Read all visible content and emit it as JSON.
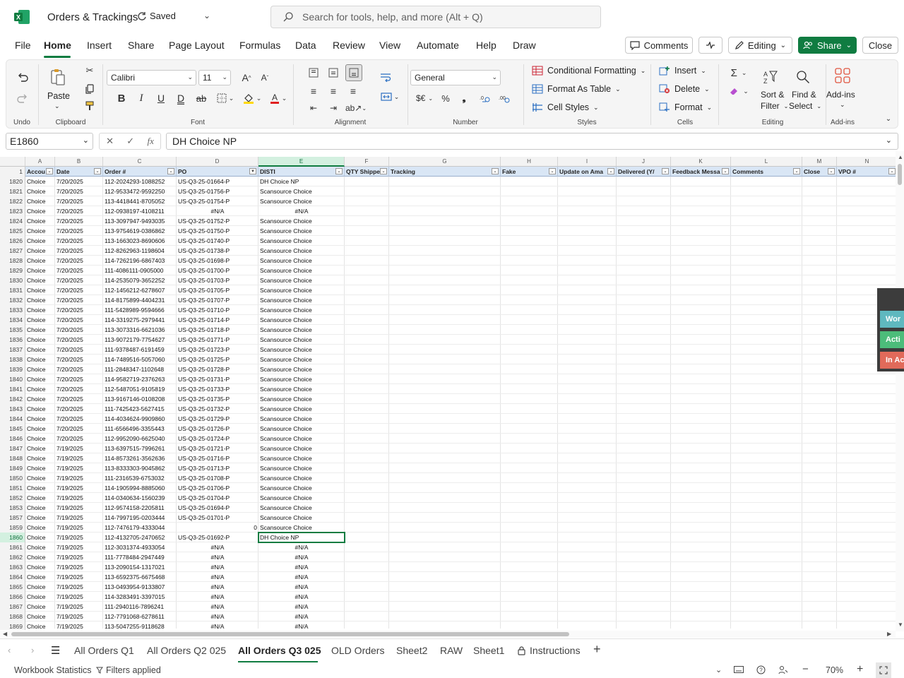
{
  "app": {
    "title": "Orders & Trackings",
    "saved_status": "Saved",
    "search_placeholder": "Search for tools, help, and more (Alt + Q)"
  },
  "menu": {
    "items": [
      "File",
      "Home",
      "Insert",
      "Share",
      "Page Layout",
      "Formulas",
      "Data",
      "Review",
      "View",
      "Automate",
      "Help",
      "Draw"
    ],
    "active": "Home",
    "comments": "Comments",
    "editing": "Editing",
    "share": "Share",
    "close": "Close"
  },
  "ribbon": {
    "undo_label": "Undo",
    "paste_label": "Paste",
    "clipboard_label": "Clipboard",
    "font_name": "Calibri",
    "font_size": "11",
    "font_label": "Font",
    "alignment_label": "Alignment",
    "number_format": "General",
    "number_label": "Number",
    "conditional_formatting": "Conditional Formatting",
    "format_as_table": "Format As Table",
    "cell_styles": "Cell Styles",
    "styles_label": "Styles",
    "insert": "Insert",
    "delete": "Delete",
    "format": "Format",
    "cells_label": "Cells",
    "sort_filter_1": "Sort &",
    "sort_filter_2": "Filter",
    "find_select_1": "Find &",
    "find_select_2": "Select",
    "editing_label": "Editing",
    "addins": "Add-ins",
    "addins_label": "Add-ins"
  },
  "formula_bar": {
    "name_box": "E1860",
    "formula": "DH Choice NP"
  },
  "columns": [
    {
      "letter": "A",
      "header": "Accou"
    },
    {
      "letter": "B",
      "header": "Date"
    },
    {
      "letter": "C",
      "header": "Order #"
    },
    {
      "letter": "D",
      "header": "PO"
    },
    {
      "letter": "E",
      "header": "DISTI"
    },
    {
      "letter": "F",
      "header": "QTY Shippe"
    },
    {
      "letter": "G",
      "header": "Tracking"
    },
    {
      "letter": "H",
      "header": "Fake"
    },
    {
      "letter": "I",
      "header": "Update on Ama"
    },
    {
      "letter": "J",
      "header": "Delivered (Y/"
    },
    {
      "letter": "K",
      "header": "Feedback Messa"
    },
    {
      "letter": "L",
      "header": "Comments"
    },
    {
      "letter": "M",
      "header": "Close"
    },
    {
      "letter": "N",
      "header": "VPO #"
    }
  ],
  "header_row_number": "1",
  "rows": [
    {
      "n": "1820",
      "a": "Choice",
      "b": "7/20/2025",
      "c": "112-2024293-1088252",
      "d": "US-Q3-25-01664-P",
      "e": "DH Choice NP",
      "f": ""
    },
    {
      "n": "1821",
      "a": "Choice",
      "b": "7/20/2025",
      "c": "112-9533472-9592250",
      "d": "US-Q3-25-01756-P",
      "e": "Scansource Choice",
      "f": ""
    },
    {
      "n": "1822",
      "a": "Choice",
      "b": "7/20/2025",
      "c": "113-4418441-8705052",
      "d": "US-Q3-25-01754-P",
      "e": "Scansource Choice",
      "f": ""
    },
    {
      "n": "1823",
      "a": "Choice",
      "b": "7/20/2025",
      "c": "112-0938197-4108211",
      "d": "#N/A",
      "e": "#N/A",
      "f": ""
    },
    {
      "n": "1824",
      "a": "Choice",
      "b": "7/20/2025",
      "c": "113-3097947-9493035",
      "d": "US-Q3-25-01752-P",
      "e": "Scansource Choice",
      "f": ""
    },
    {
      "n": "1825",
      "a": "Choice",
      "b": "7/20/2025",
      "c": "113-9754619-0386862",
      "d": "US-Q3-25-01750-P",
      "e": "Scansource Choice",
      "f": ""
    },
    {
      "n": "1826",
      "a": "Choice",
      "b": "7/20/2025",
      "c": "113-1663023-8690606",
      "d": "US-Q3-25-01740-P",
      "e": "Scansource Choice",
      "f": ""
    },
    {
      "n": "1827",
      "a": "Choice",
      "b": "7/20/2025",
      "c": "112-8262963-1198604",
      "d": "US-Q3-25-01738-P",
      "e": "Scansource Choice",
      "f": ""
    },
    {
      "n": "1828",
      "a": "Choice",
      "b": "7/20/2025",
      "c": "114-7262196-6867403",
      "d": "US-Q3-25-01698-P",
      "e": "Scansource Choice",
      "f": ""
    },
    {
      "n": "1829",
      "a": "Choice",
      "b": "7/20/2025",
      "c": "111-4086111-0905000",
      "d": "US-Q3-25-01700-P",
      "e": "Scansource Choice",
      "f": ""
    },
    {
      "n": "1830",
      "a": "Choice",
      "b": "7/20/2025",
      "c": "114-2535079-3652252",
      "d": "US-Q3-25-01703-P",
      "e": "Scansource Choice",
      "f": ""
    },
    {
      "n": "1831",
      "a": "Choice",
      "b": "7/20/2025",
      "c": "112-1456212-6278607",
      "d": "US-Q3-25-01705-P",
      "e": "Scansource Choice",
      "f": ""
    },
    {
      "n": "1832",
      "a": "Choice",
      "b": "7/20/2025",
      "c": "114-8175899-4404231",
      "d": "US-Q3-25-01707-P",
      "e": "Scansource Choice",
      "f": ""
    },
    {
      "n": "1833",
      "a": "Choice",
      "b": "7/20/2025",
      "c": "111-5428989-9594666",
      "d": "US-Q3-25-01710-P",
      "e": "Scansource Choice",
      "f": ""
    },
    {
      "n": "1834",
      "a": "Choice",
      "b": "7/20/2025",
      "c": "114-3319275-2979441",
      "d": "US-Q3-25-01714-P",
      "e": "Scansource Choice",
      "f": ""
    },
    {
      "n": "1835",
      "a": "Choice",
      "b": "7/20/2025",
      "c": "113-3073316-6621036",
      "d": "US-Q3-25-01718-P",
      "e": "Scansource Choice",
      "f": ""
    },
    {
      "n": "1836",
      "a": "Choice",
      "b": "7/20/2025",
      "c": "113-9072179-7754627",
      "d": "US-Q3-25-01771-P",
      "e": "Scansource Choice",
      "f": ""
    },
    {
      "n": "1837",
      "a": "Choice",
      "b": "7/20/2025",
      "c": "111-9378487-6191459",
      "d": "US-Q3-25-01723-P",
      "e": "Scansource Choice",
      "f": ""
    },
    {
      "n": "1838",
      "a": "Choice",
      "b": "7/20/2025",
      "c": "114-7489516-5057060",
      "d": "US-Q3-25-01725-P",
      "e": "Scansource Choice",
      "f": ""
    },
    {
      "n": "1839",
      "a": "Choice",
      "b": "7/20/2025",
      "c": "111-2848347-1102648",
      "d": "US-Q3-25-01728-P",
      "e": "Scansource Choice",
      "f": ""
    },
    {
      "n": "1840",
      "a": "Choice",
      "b": "7/20/2025",
      "c": "114-9582719-2376263",
      "d": "US-Q3-25-01731-P",
      "e": "Scansource Choice",
      "f": ""
    },
    {
      "n": "1841",
      "a": "Choice",
      "b": "7/20/2025",
      "c": "112-5487051-9105819",
      "d": "US-Q3-25-01733-P",
      "e": "Scansource Choice",
      "f": ""
    },
    {
      "n": "1842",
      "a": "Choice",
      "b": "7/20/2025",
      "c": "113-9167146-0108208",
      "d": "US-Q3-25-01735-P",
      "e": "Scansource Choice",
      "f": ""
    },
    {
      "n": "1843",
      "a": "Choice",
      "b": "7/20/2025",
      "c": "111-7425423-5627415",
      "d": "US-Q3-25-01732-P",
      "e": "Scansource Choice",
      "f": ""
    },
    {
      "n": "1844",
      "a": "Choice",
      "b": "7/20/2025",
      "c": "114-4034624-9909860",
      "d": "US-Q3-25-01729-P",
      "e": "Scansource Choice",
      "f": ""
    },
    {
      "n": "1845",
      "a": "Choice",
      "b": "7/20/2025",
      "c": "111-6566496-3355443",
      "d": "US-Q3-25-01726-P",
      "e": "Scansource Choice",
      "f": ""
    },
    {
      "n": "1846",
      "a": "Choice",
      "b": "7/20/2025",
      "c": "112-9952090-6625040",
      "d": "US-Q3-25-01724-P",
      "e": "Scansource Choice",
      "f": ""
    },
    {
      "n": "1847",
      "a": "Choice",
      "b": "7/19/2025",
      "c": "113-6397515-7996261",
      "d": "US-Q3-25-01721-P",
      "e": "Scansource Choice",
      "f": ""
    },
    {
      "n": "1848",
      "a": "Choice",
      "b": "7/19/2025",
      "c": "114-8573261-3562636",
      "d": "US-Q3-25-01716-P",
      "e": "Scansource Choice",
      "f": ""
    },
    {
      "n": "1849",
      "a": "Choice",
      "b": "7/19/2025",
      "c": "113-8333303-9045862",
      "d": "US-Q3-25-01713-P",
      "e": "Scansource Choice",
      "f": ""
    },
    {
      "n": "1850",
      "a": "Choice",
      "b": "7/19/2025",
      "c": "111-2316539-6753032",
      "d": "US-Q3-25-01708-P",
      "e": "Scansource Choice",
      "f": ""
    },
    {
      "n": "1851",
      "a": "Choice",
      "b": "7/19/2025",
      "c": "114-1905994-8885060",
      "d": "US-Q3-25-01706-P",
      "e": "Scansource Choice",
      "f": ""
    },
    {
      "n": "1852",
      "a": "Choice",
      "b": "7/19/2025",
      "c": "114-0340634-1560239",
      "d": "US-Q3-25-01704-P",
      "e": "Scansource Choice",
      "f": ""
    },
    {
      "n": "1853",
      "a": "Choice",
      "b": "7/19/2025",
      "c": "112-9574158-2205811",
      "d": "US-Q3-25-01694-P",
      "e": "Scansource Choice",
      "f": ""
    },
    {
      "n": "1857",
      "a": "Choice",
      "b": "7/19/2025",
      "c": "114-7997195-0203444",
      "d": "US-Q3-25-01701-P",
      "e": "Scansource Choice",
      "f": ""
    },
    {
      "n": "1859",
      "a": "Choice",
      "b": "7/19/2025",
      "c": "112-7476179-4333044",
      "d": "0",
      "e": "Scansource Choice",
      "f": ""
    },
    {
      "n": "1860",
      "a": "Choice",
      "b": "7/19/2025",
      "c": "112-4132705-2470652",
      "d": "US-Q3-25-01692-P",
      "e": "DH Choice NP",
      "f": ""
    },
    {
      "n": "1861",
      "a": "Choice",
      "b": "7/19/2025",
      "c": "112-3031374-4933054",
      "d": "#N/A",
      "e": "#N/A",
      "f": ""
    },
    {
      "n": "1862",
      "a": "Choice",
      "b": "7/19/2025",
      "c": "111-7778484-2947449",
      "d": "#N/A",
      "e": "#N/A",
      "f": ""
    },
    {
      "n": "1863",
      "a": "Choice",
      "b": "7/19/2025",
      "c": "113-2090154-1317021",
      "d": "#N/A",
      "e": "#N/A",
      "f": ""
    },
    {
      "n": "1864",
      "a": "Choice",
      "b": "7/19/2025",
      "c": "113-6592375-6675468",
      "d": "#N/A",
      "e": "#N/A",
      "f": ""
    },
    {
      "n": "1865",
      "a": "Choice",
      "b": "7/19/2025",
      "c": "113-0493954-9133807",
      "d": "#N/A",
      "e": "#N/A",
      "f": ""
    },
    {
      "n": "1866",
      "a": "Choice",
      "b": "7/19/2025",
      "c": "114-3283491-3397015",
      "d": "#N/A",
      "e": "#N/A",
      "f": ""
    },
    {
      "n": "1867",
      "a": "Choice",
      "b": "7/19/2025",
      "c": "111-2940116-7896241",
      "d": "#N/A",
      "e": "#N/A",
      "f": ""
    },
    {
      "n": "1868",
      "a": "Choice",
      "b": "7/19/2025",
      "c": "112-7791068-6278611",
      "d": "#N/A",
      "e": "#N/A",
      "f": ""
    },
    {
      "n": "1869",
      "a": "Choice",
      "b": "7/19/2025",
      "c": "113-5047255-9118628",
      "d": "#N/A",
      "e": "#N/A",
      "f": ""
    }
  ],
  "selected_row": "1860",
  "side_panel": [
    "Wor",
    "Acti",
    "In Ac"
  ],
  "sheet_tabs": [
    "All Orders Q1",
    "All Orders Q2 025",
    "All Orders Q3 025",
    "OLD Orders",
    "Sheet2",
    "RAW",
    "Sheet1",
    "Instructions"
  ],
  "active_sheet": "All Orders Q3 025",
  "status": {
    "workbook_statistics": "Workbook Statistics",
    "filters": "Filters applied",
    "zoom": "70%"
  },
  "colors": {
    "accent": "#107c41",
    "header_fill": "#d9e6f5",
    "side_teal": "#5fb8bf",
    "side_green": "#4cbc7a",
    "side_red": "#e16a5a"
  }
}
